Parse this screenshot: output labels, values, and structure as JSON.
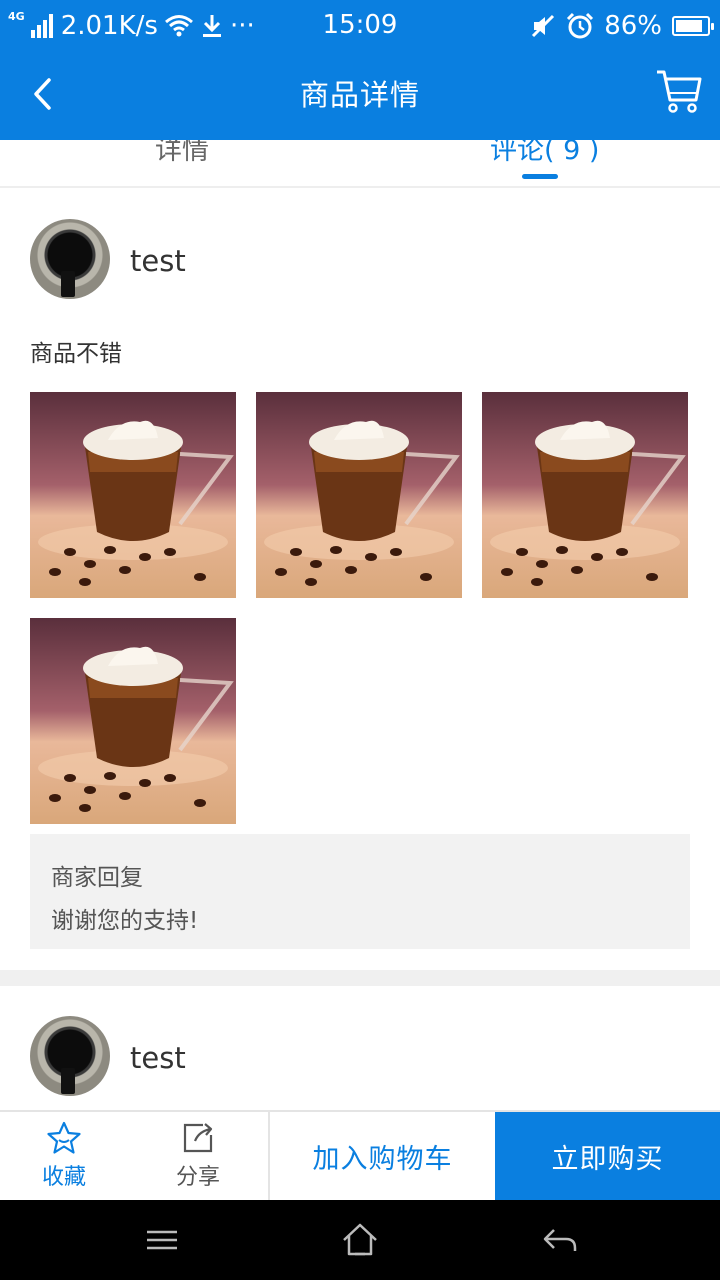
{
  "status_bar": {
    "network_type": "4G",
    "speed": "2.01K/s",
    "more": "···",
    "time": "15:09",
    "battery_percent": "86%",
    "battery_level": 0.86
  },
  "nav": {
    "title": "商品详情"
  },
  "tabs": [
    {
      "label": "详情"
    },
    {
      "label": "评论( 9 )"
    }
  ],
  "reviews": [
    {
      "username": "test",
      "text": "商品不错",
      "photo_count": 4,
      "reply": {
        "title": "商家回复",
        "text": "谢谢您的支持!"
      }
    },
    {
      "username": "test"
    }
  ],
  "actions": {
    "favorite_label": "收藏",
    "share_label": "分享",
    "add_to_cart_label": "加入购物车",
    "buy_now_label": "立即购买"
  },
  "colors": {
    "primary": "#0a7fe0",
    "reply_bg": "#f2f2f2"
  }
}
